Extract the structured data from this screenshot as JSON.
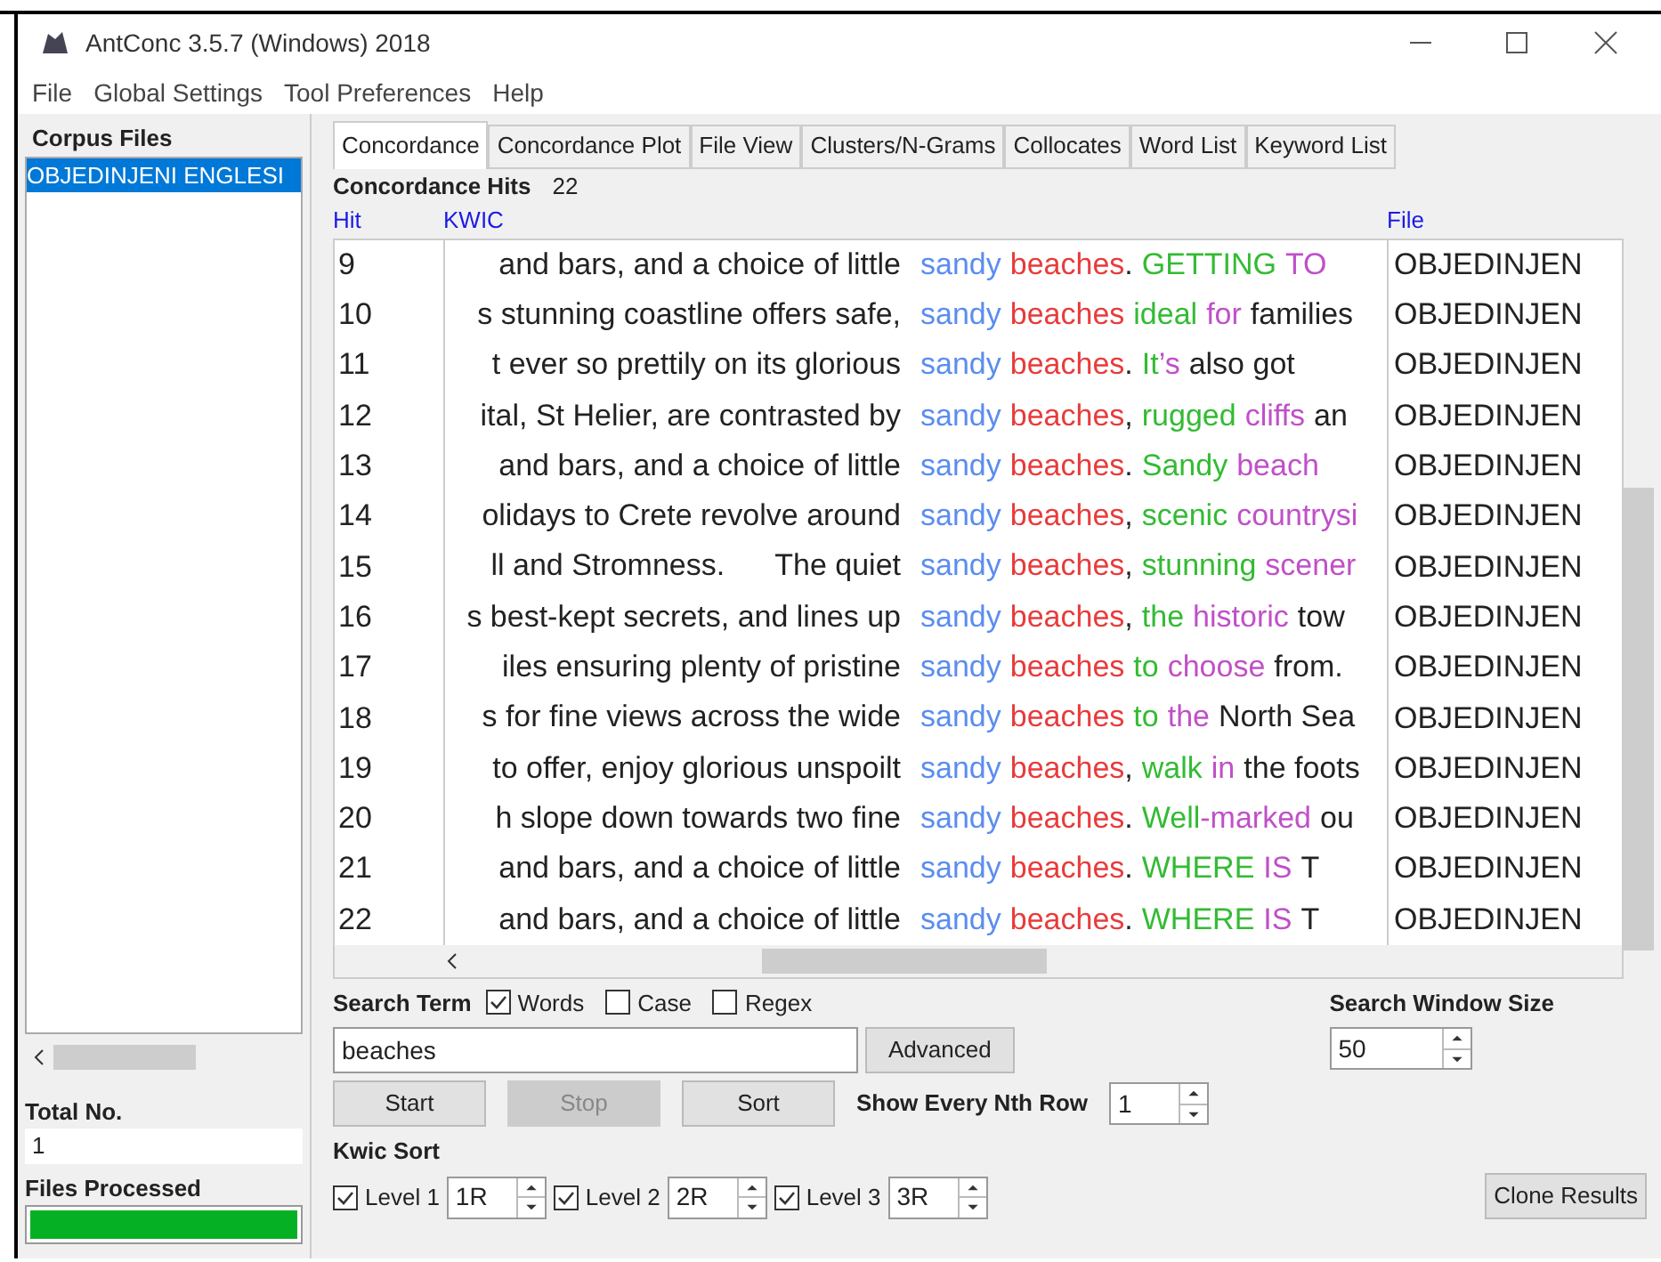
{
  "window": {
    "title": "AntConc 3.5.7 (Windows) 2018"
  },
  "menu": [
    "File",
    "Global Settings",
    "Tool Preferences",
    "Help"
  ],
  "sidebar": {
    "title": "Corpus Files",
    "files": [
      {
        "name": "OBJEDINJENI ENGLESI",
        "selected": true
      }
    ],
    "total_label": "Total No.",
    "total_value": "1",
    "processed_label": "Files Processed",
    "progress": {
      "level": 1
    }
  },
  "tabs": [
    {
      "label": "Concordance",
      "selected": true
    },
    {
      "label": "Concordance Plot",
      "selected": false
    },
    {
      "label": "File View",
      "selected": false
    },
    {
      "label": "Clusters/N-Grams",
      "selected": false
    },
    {
      "label": "Collocates",
      "selected": false
    },
    {
      "label": "Word List",
      "selected": false
    },
    {
      "label": "Keyword List",
      "selected": false
    }
  ],
  "hits": {
    "label": "Concordance Hits",
    "count": "22"
  },
  "table": {
    "columns": [
      "Hit",
      "KWIC",
      "File"
    ],
    "rows": [
      {
        "hit": "9",
        "left": "and bars, and a choice of little",
        "words": [
          {
            "parts": [
              {
                "text": "sandy",
                "color": "#5b8def"
              }
            ]
          },
          {
            "parts": [
              {
                "text": "beaches",
                "color": "#e83b3b"
              },
              {
                "text": ".",
                "color": "#222222"
              }
            ]
          },
          {
            "parts": [
              {
                "text": "GETTING",
                "color": "#33bb33"
              }
            ]
          },
          {
            "parts": [
              {
                "text": "TO",
                "color": "#c050c8"
              }
            ]
          }
        ],
        "file": "OBJEDINJEN"
      },
      {
        "hit": "10",
        "left": "s stunning coastline offers safe,",
        "words": [
          {
            "parts": [
              {
                "text": "sandy",
                "color": "#5b8def"
              }
            ]
          },
          {
            "parts": [
              {
                "text": "beaches",
                "color": "#e83b3b"
              }
            ]
          },
          {
            "parts": [
              {
                "text": "ideal",
                "color": "#33bb33"
              }
            ]
          },
          {
            "parts": [
              {
                "text": "for",
                "color": "#c050c8"
              }
            ]
          },
          {
            "parts": [
              {
                "text": "families",
                "color": "#222222"
              }
            ]
          }
        ],
        "file": "OBJEDINJEN"
      },
      {
        "hit": "11",
        "left": "t ever so prettily on its glorious",
        "words": [
          {
            "parts": [
              {
                "text": "sandy",
                "color": "#5b8def"
              }
            ]
          },
          {
            "parts": [
              {
                "text": "beaches",
                "color": "#e83b3b"
              },
              {
                "text": ".",
                "color": "#222222"
              }
            ]
          },
          {
            "parts": [
              {
                "text": "It",
                "color": "#33bb33"
              },
              {
                "text": "’s",
                "color": "#c050c8"
              }
            ]
          },
          {
            "parts": [
              {
                "text": "also got",
                "color": "#222222"
              }
            ]
          }
        ],
        "file": "OBJEDINJEN"
      },
      {
        "hit": "12",
        "left": "ital, St Helier, are contrasted by",
        "words": [
          {
            "parts": [
              {
                "text": "sandy",
                "color": "#5b8def"
              }
            ]
          },
          {
            "parts": [
              {
                "text": "beaches",
                "color": "#e83b3b"
              },
              {
                "text": ",",
                "color": "#222222"
              }
            ]
          },
          {
            "parts": [
              {
                "text": "rugged",
                "color": "#33bb33"
              }
            ]
          },
          {
            "parts": [
              {
                "text": "cliffs",
                "color": "#c050c8"
              }
            ]
          },
          {
            "parts": [
              {
                "text": "an",
                "color": "#222222"
              }
            ]
          }
        ],
        "file": "OBJEDINJEN"
      },
      {
        "hit": "13",
        "left": "and bars, and a choice of little",
        "words": [
          {
            "parts": [
              {
                "text": "sandy",
                "color": "#5b8def"
              }
            ]
          },
          {
            "parts": [
              {
                "text": "beaches",
                "color": "#e83b3b"
              },
              {
                "text": ".",
                "color": "#222222"
              }
            ]
          },
          {
            "parts": [
              {
                "text": "Sandy",
                "color": "#33bb33"
              }
            ]
          },
          {
            "parts": [
              {
                "text": "beach",
                "color": "#c050c8"
              }
            ]
          }
        ],
        "file": "OBJEDINJEN"
      },
      {
        "hit": "14",
        "left": "olidays to Crete revolve around",
        "words": [
          {
            "parts": [
              {
                "text": "sandy",
                "color": "#5b8def"
              }
            ]
          },
          {
            "parts": [
              {
                "text": "beaches",
                "color": "#e83b3b"
              },
              {
                "text": ",",
                "color": "#222222"
              }
            ]
          },
          {
            "parts": [
              {
                "text": "scenic",
                "color": "#33bb33"
              }
            ]
          },
          {
            "parts": [
              {
                "text": "countrysi",
                "color": "#c050c8"
              }
            ]
          }
        ],
        "file": "OBJEDINJEN"
      },
      {
        "hit": "15",
        "left": "ll and Stromness.      The quiet",
        "words": [
          {
            "parts": [
              {
                "text": "sandy",
                "color": "#5b8def"
              }
            ]
          },
          {
            "parts": [
              {
                "text": "beaches",
                "color": "#e83b3b"
              },
              {
                "text": ",",
                "color": "#222222"
              }
            ]
          },
          {
            "parts": [
              {
                "text": "stunning",
                "color": "#33bb33"
              }
            ]
          },
          {
            "parts": [
              {
                "text": "scener",
                "color": "#c050c8"
              }
            ]
          }
        ],
        "file": "OBJEDINJEN"
      },
      {
        "hit": "16",
        "left": "s best-kept secrets, and lines up",
        "words": [
          {
            "parts": [
              {
                "text": "sandy",
                "color": "#5b8def"
              }
            ]
          },
          {
            "parts": [
              {
                "text": "beaches",
                "color": "#e83b3b"
              },
              {
                "text": ",",
                "color": "#222222"
              }
            ]
          },
          {
            "parts": [
              {
                "text": "the",
                "color": "#33bb33"
              }
            ]
          },
          {
            "parts": [
              {
                "text": "historic",
                "color": "#c050c8"
              }
            ]
          },
          {
            "parts": [
              {
                "text": "tow",
                "color": "#222222"
              }
            ]
          }
        ],
        "file": "OBJEDINJEN"
      },
      {
        "hit": "17",
        "left": "iles ensuring plenty of pristine",
        "words": [
          {
            "parts": [
              {
                "text": "sandy",
                "color": "#5b8def"
              }
            ]
          },
          {
            "parts": [
              {
                "text": "beaches",
                "color": "#e83b3b"
              }
            ]
          },
          {
            "parts": [
              {
                "text": "to",
                "color": "#33bb33"
              }
            ]
          },
          {
            "parts": [
              {
                "text": "choose",
                "color": "#c050c8"
              }
            ]
          },
          {
            "parts": [
              {
                "text": "from.",
                "color": "#222222"
              }
            ]
          }
        ],
        "file": "OBJEDINJEN"
      },
      {
        "hit": "18",
        "left": "s for fine views across the wide",
        "words": [
          {
            "parts": [
              {
                "text": "sandy",
                "color": "#5b8def"
              }
            ]
          },
          {
            "parts": [
              {
                "text": "beaches",
                "color": "#e83b3b"
              }
            ]
          },
          {
            "parts": [
              {
                "text": "to",
                "color": "#33bb33"
              }
            ]
          },
          {
            "parts": [
              {
                "text": "the",
                "color": "#c050c8"
              }
            ]
          },
          {
            "parts": [
              {
                "text": "North Sea",
                "color": "#222222"
              }
            ]
          }
        ],
        "file": "OBJEDINJEN"
      },
      {
        "hit": "19",
        "left": "to offer, enjoy glorious unspoilt",
        "words": [
          {
            "parts": [
              {
                "text": "sandy",
                "color": "#5b8def"
              }
            ]
          },
          {
            "parts": [
              {
                "text": "beaches",
                "color": "#e83b3b"
              },
              {
                "text": ",",
                "color": "#222222"
              }
            ]
          },
          {
            "parts": [
              {
                "text": "walk",
                "color": "#33bb33"
              }
            ]
          },
          {
            "parts": [
              {
                "text": "in",
                "color": "#c050c8"
              }
            ]
          },
          {
            "parts": [
              {
                "text": "the foots",
                "color": "#222222"
              }
            ]
          }
        ],
        "file": "OBJEDINJEN"
      },
      {
        "hit": "20",
        "left": "h slope down towards two fine",
        "words": [
          {
            "parts": [
              {
                "text": "sandy",
                "color": "#5b8def"
              }
            ]
          },
          {
            "parts": [
              {
                "text": "beaches",
                "color": "#e83b3b"
              },
              {
                "text": ".",
                "color": "#222222"
              }
            ]
          },
          {
            "parts": [
              {
                "text": "Well",
                "color": "#33bb33"
              },
              {
                "text": "-marked",
                "color": "#c050c8"
              }
            ]
          },
          {
            "parts": [
              {
                "text": "ou",
                "color": "#222222"
              }
            ]
          }
        ],
        "file": "OBJEDINJEN"
      },
      {
        "hit": "21",
        "left": "and bars, and a choice of little",
        "words": [
          {
            "parts": [
              {
                "text": "sandy",
                "color": "#5b8def"
              }
            ]
          },
          {
            "parts": [
              {
                "text": "beaches",
                "color": "#e83b3b"
              },
              {
                "text": ".",
                "color": "#222222"
              }
            ]
          },
          {
            "parts": [
              {
                "text": "WHERE",
                "color": "#33bb33"
              }
            ]
          },
          {
            "parts": [
              {
                "text": "IS",
                "color": "#c050c8"
              }
            ]
          },
          {
            "parts": [
              {
                "text": "T",
                "color": "#222222"
              }
            ]
          }
        ],
        "file": "OBJEDINJEN"
      },
      {
        "hit": "22",
        "left": "and bars, and a choice of little",
        "words": [
          {
            "parts": [
              {
                "text": "sandy",
                "color": "#5b8def"
              }
            ]
          },
          {
            "parts": [
              {
                "text": "beaches",
                "color": "#e83b3b"
              },
              {
                "text": ".",
                "color": "#222222"
              }
            ]
          },
          {
            "parts": [
              {
                "text": "WHERE",
                "color": "#33bb33"
              }
            ]
          },
          {
            "parts": [
              {
                "text": "IS",
                "color": "#c050c8"
              }
            ]
          },
          {
            "parts": [
              {
                "text": "T",
                "color": "#222222"
              }
            ]
          }
        ],
        "file": "OBJEDINJEN"
      }
    ]
  },
  "search": {
    "label": "Search Term",
    "options": [
      {
        "label": "Words",
        "checked": true
      },
      {
        "label": "Case",
        "checked": false
      },
      {
        "label": "Regex",
        "checked": false
      }
    ],
    "value": "beaches",
    "advanced": "Advanced"
  },
  "buttons": [
    {
      "label": "Start",
      "disabled": false
    },
    {
      "label": "Stop",
      "disabled": true
    },
    {
      "label": "Sort",
      "disabled": false
    }
  ],
  "nth_row": {
    "label": "Show Every Nth Row",
    "value": "1"
  },
  "window_size": {
    "label": "Search Window Size",
    "value": "50"
  },
  "kwic_sort": {
    "label": "Kwic Sort",
    "levels": [
      {
        "label": "Level 1",
        "checked": true,
        "value": "1R"
      },
      {
        "label": "Level 2",
        "checked": true,
        "value": "2R"
      },
      {
        "label": "Level 3",
        "checked": true,
        "value": "3R"
      }
    ]
  },
  "clone": "Clone Results"
}
